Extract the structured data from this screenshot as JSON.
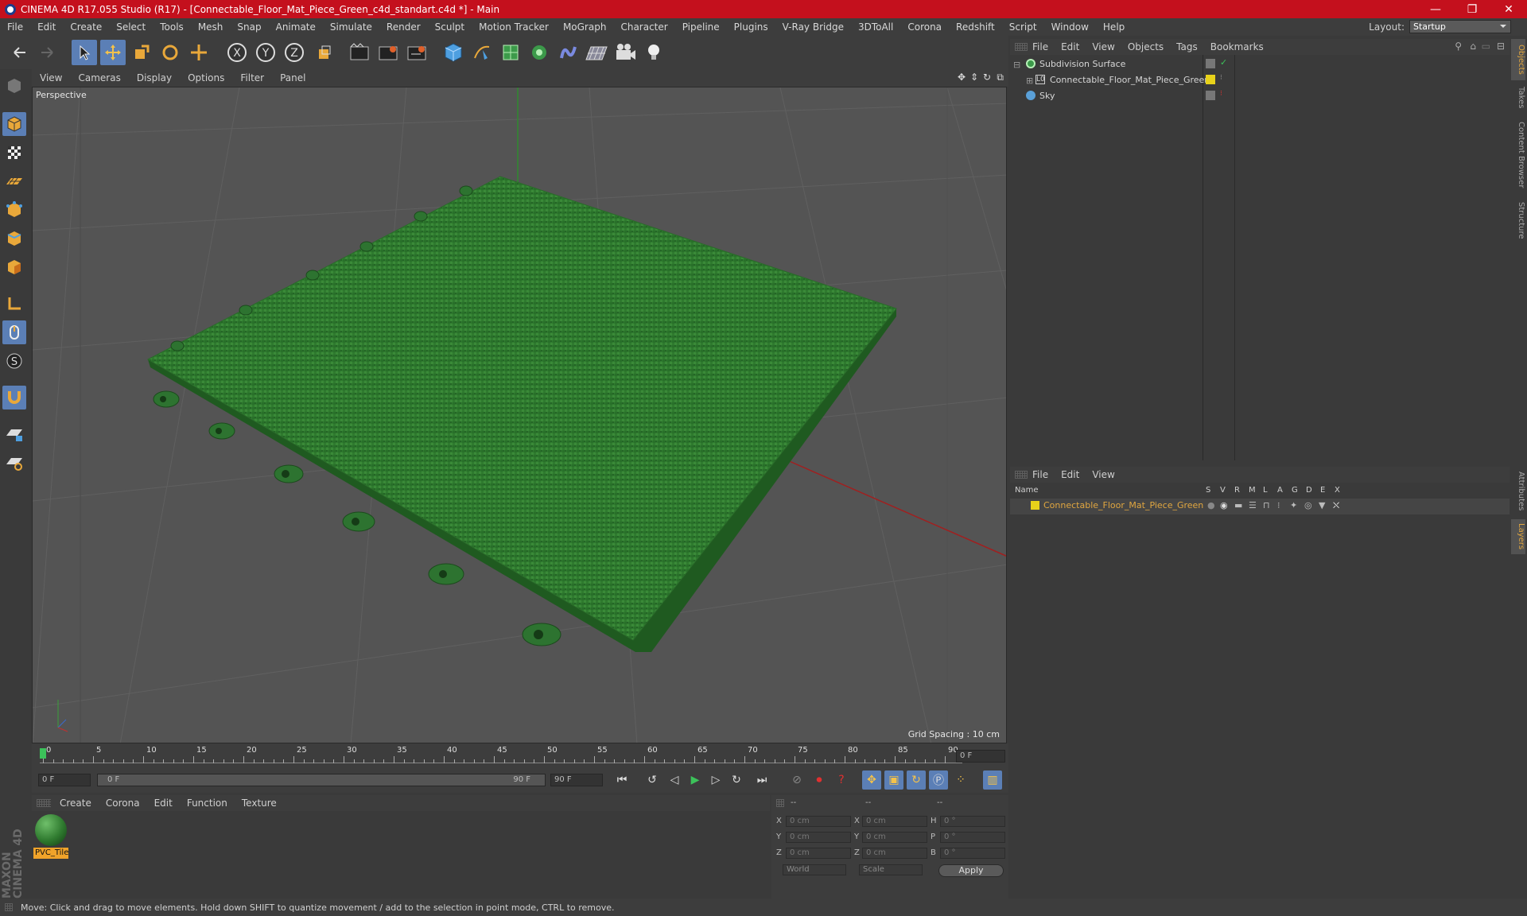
{
  "window": {
    "title": "CINEMA 4D R17.055 Studio (R17) - [Connectable_Floor_Mat_Piece_Green_c4d_standart.c4d *] - Main"
  },
  "menubar": {
    "items": [
      "File",
      "Edit",
      "Create",
      "Select",
      "Tools",
      "Mesh",
      "Snap",
      "Animate",
      "Simulate",
      "Render",
      "Sculpt",
      "Motion Tracker",
      "MoGraph",
      "Character",
      "Pipeline",
      "Plugins",
      "V-Ray Bridge",
      "3DToAll",
      "Corona",
      "Redshift",
      "Script",
      "Window",
      "Help"
    ],
    "layout_label": "Layout:",
    "layout_value": "Startup"
  },
  "viewport": {
    "menu": [
      "View",
      "Cameras",
      "Display",
      "Options",
      "Filter",
      "Panel"
    ],
    "label": "Perspective",
    "grid_spacing": "Grid Spacing : 10 cm"
  },
  "timeline": {
    "ticks": [
      "0",
      "5",
      "10",
      "15",
      "20",
      "25",
      "30",
      "35",
      "40",
      "45",
      "50",
      "55",
      "60",
      "65",
      "70",
      "75",
      "80",
      "85",
      "90"
    ],
    "current_frame": "0 F",
    "start_field": "0 F",
    "range_start": "0 F",
    "range_end": "90 F",
    "end_field": "90 F"
  },
  "materials": {
    "menu": [
      "Create",
      "Corona",
      "Edit",
      "Function",
      "Texture"
    ],
    "items": [
      {
        "name": "PVC_Tile"
      }
    ]
  },
  "coords": {
    "headers": [
      "--",
      "--",
      "--"
    ],
    "rows": [
      {
        "a": "X",
        "av": "0 cm",
        "b": "X",
        "bv": "0 cm",
        "c": "H",
        "cv": "0 °"
      },
      {
        "a": "Y",
        "av": "0 cm",
        "b": "Y",
        "bv": "0 cm",
        "c": "P",
        "cv": "0 °"
      },
      {
        "a": "Z",
        "av": "0 cm",
        "b": "Z",
        "bv": "0 cm",
        "c": "B",
        "cv": "0 °"
      }
    ],
    "mode_world": "World",
    "mode_scale": "Scale",
    "apply": "Apply"
  },
  "object_manager": {
    "menu": [
      "File",
      "Edit",
      "View",
      "Objects",
      "Tags",
      "Bookmarks"
    ],
    "objects": [
      {
        "name": "Subdivision Surface"
      },
      {
        "name": "Connectable_Floor_Mat_Piece_Green"
      },
      {
        "name": "Sky"
      }
    ]
  },
  "layer_manager": {
    "menu": [
      "File",
      "Edit",
      "View"
    ],
    "name_header": "Name",
    "columns": [
      "S",
      "V",
      "R",
      "M",
      "L",
      "A",
      "G",
      "D",
      "E",
      "X"
    ],
    "layers": [
      {
        "name": "Connectable_Floor_Mat_Piece_Green"
      }
    ]
  },
  "right_tabs": [
    "Objects",
    "Takes",
    "Content Browser",
    "Structure",
    "Attributes",
    "Layers"
  ],
  "status": "Move: Click and drag to move elements. Hold down SHIFT to quantize movement / add to the selection in point mode, CTRL to remove.",
  "brand": "MAXON CINEMA 4D",
  "colors": {
    "accent": "#5b7fb6",
    "title_bar": "#c4101d",
    "object_orange": "#e0a640",
    "mat_green": "#2f7a2f"
  }
}
